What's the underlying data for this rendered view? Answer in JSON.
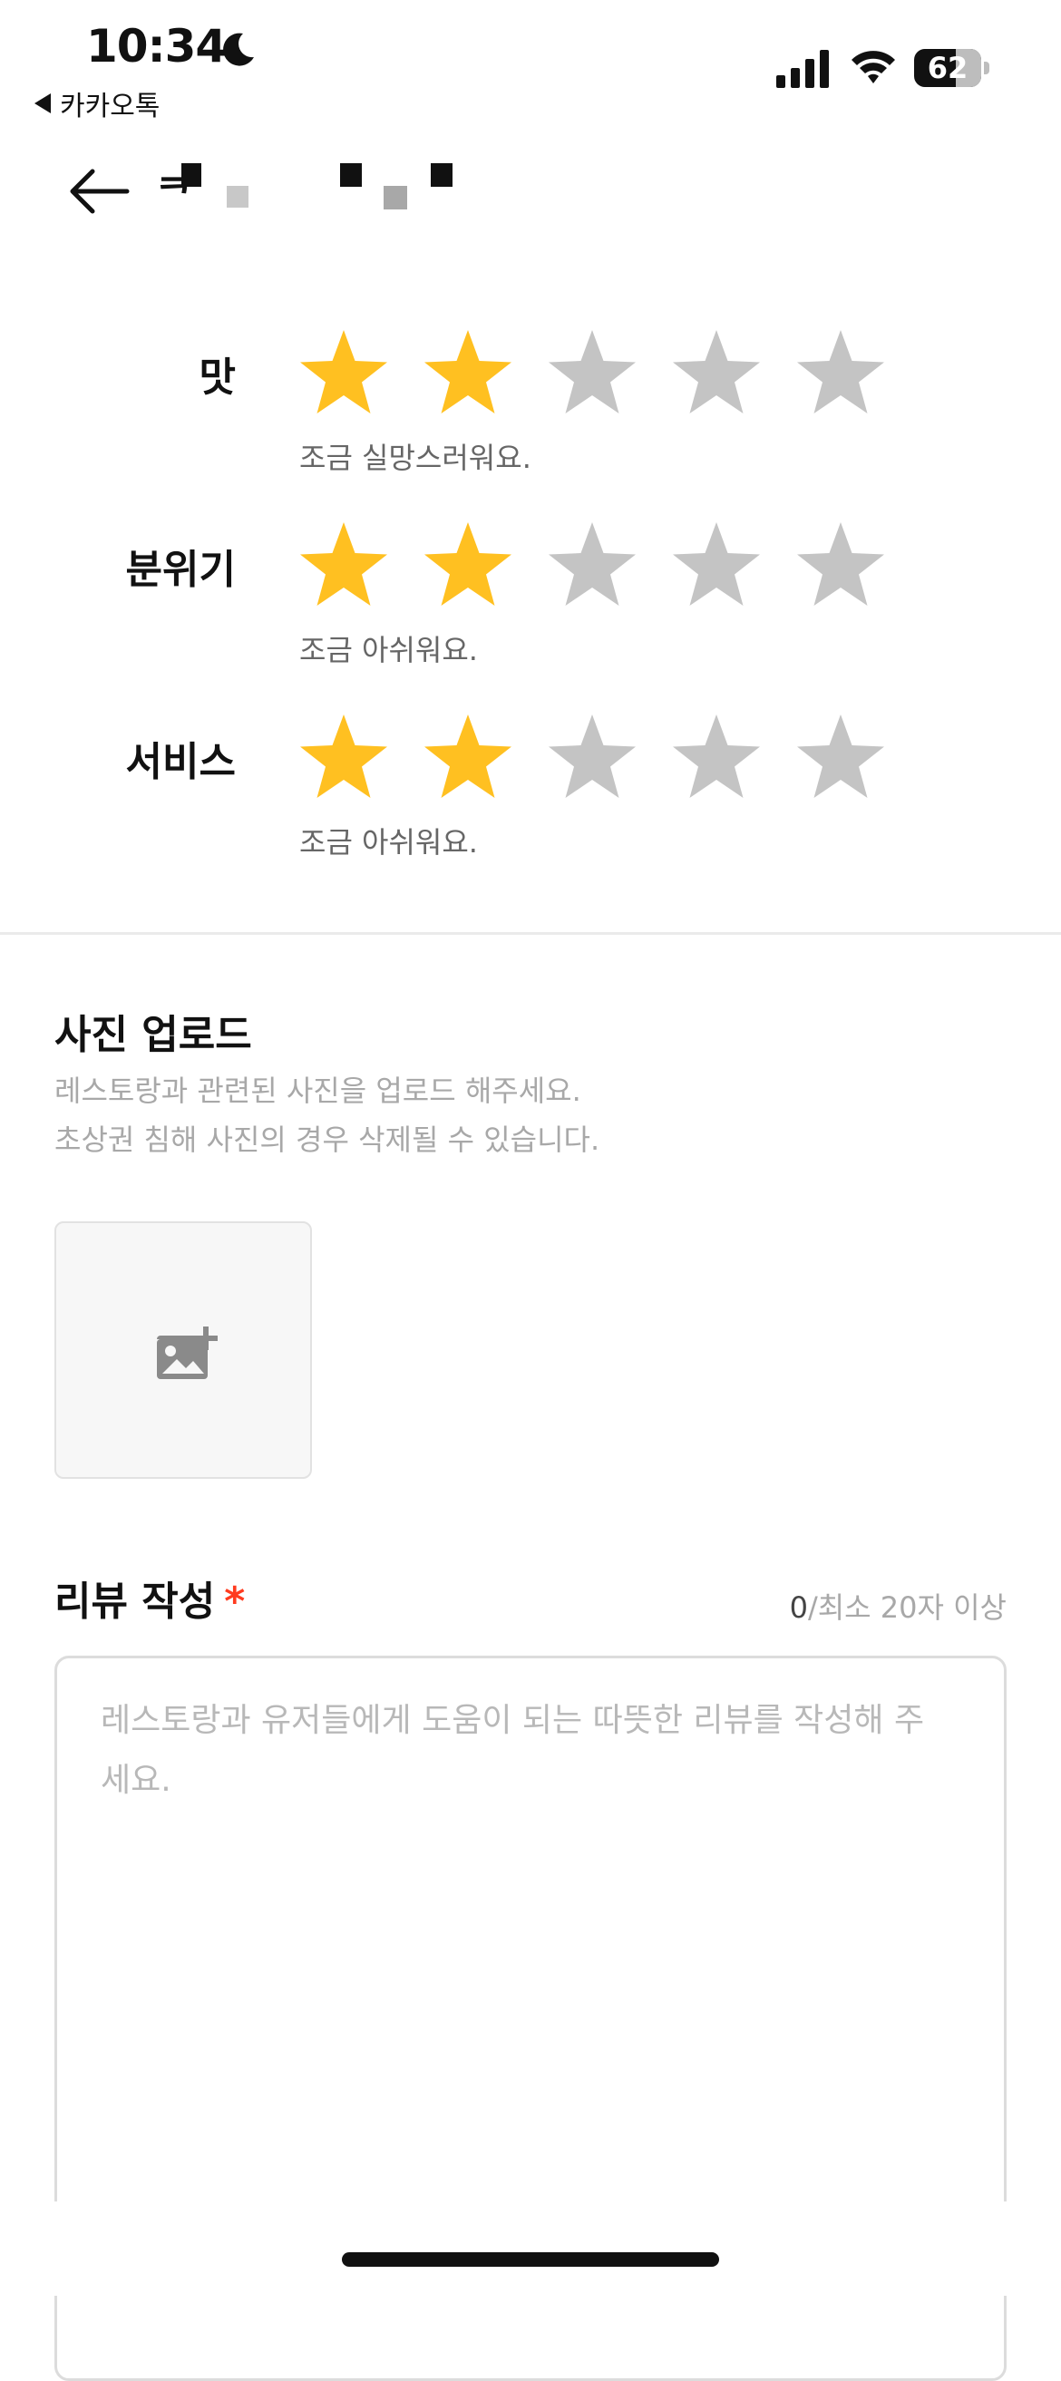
{
  "status_bar": {
    "time": "10:34",
    "back_app": "카카오톡",
    "battery": "62"
  },
  "header": {
    "title_visible": "ᄏ"
  },
  "ratings": [
    {
      "label": "맛",
      "stars": 2,
      "max": 5,
      "comment": "조금 실망스러워요."
    },
    {
      "label": "분위기",
      "stars": 2,
      "max": 5,
      "comment": "조금 아쉬워요."
    },
    {
      "label": "서비스",
      "stars": 2,
      "max": 5,
      "comment": "조금 아쉬워요."
    }
  ],
  "photo": {
    "title": "사진 업로드",
    "desc_line1": "레스토랑과 관련된 사진을 업로드 해주세요.",
    "desc_line2": "초상권 침해 사진의 경우 삭제될 수 있습니다."
  },
  "review": {
    "title": "리뷰 작성",
    "required_mark": "*",
    "count": "0",
    "count_suffix": "/최소 20자 이상",
    "placeholder": "레스토랑과 유저들에게 도움이 되는 따뜻한 리뷰를 작성해 주세요."
  },
  "colors": {
    "star_filled": "#FFC021",
    "star_empty": "#C4C4C4",
    "required": "#FF3B1F"
  }
}
